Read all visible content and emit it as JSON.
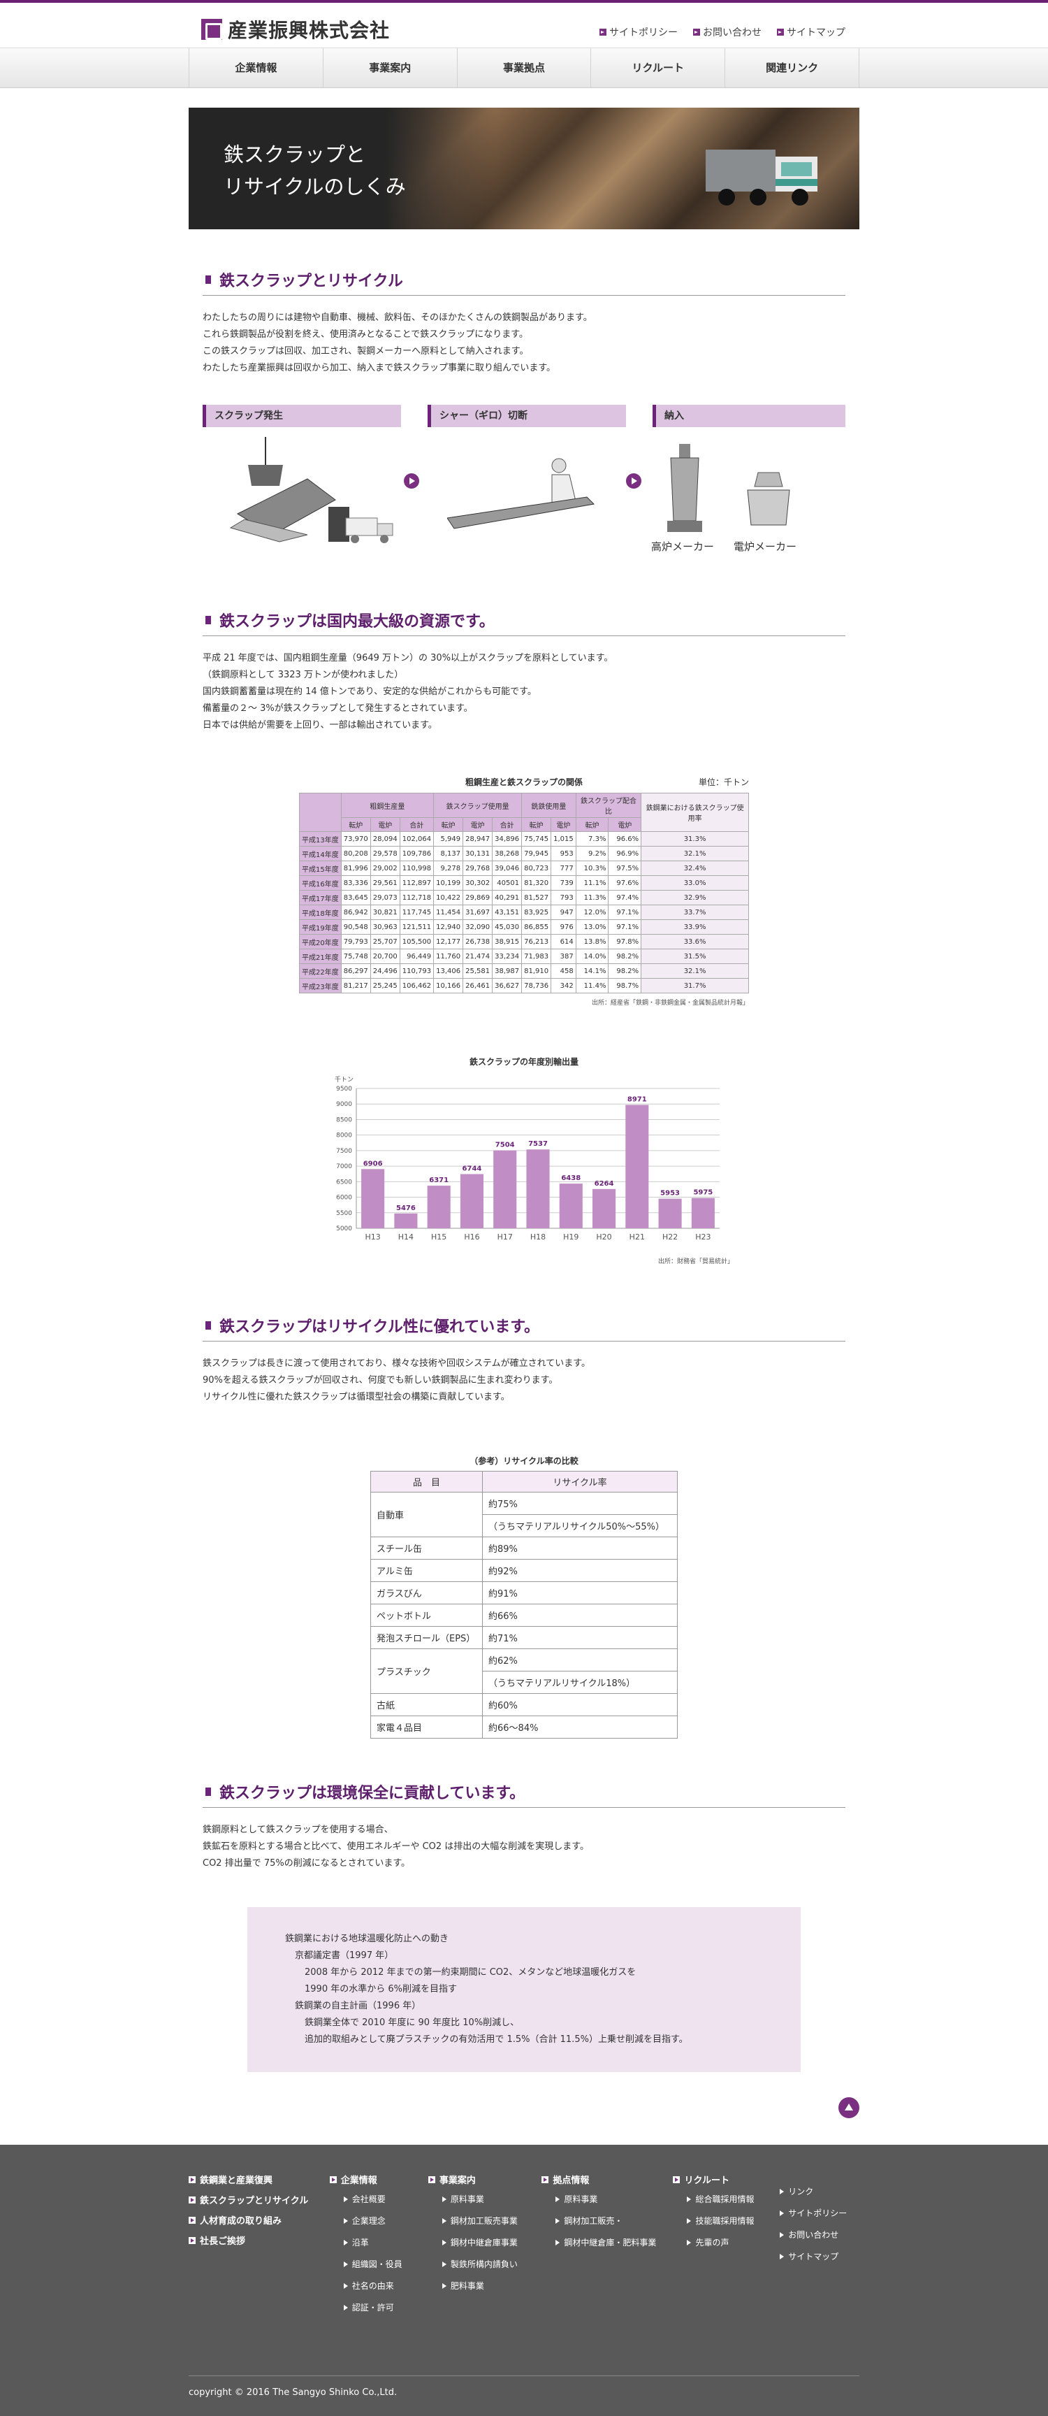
{
  "header": {
    "company": "産業振興株式会社",
    "util": [
      "サイトポリシー",
      "お問い合わせ",
      "サイトマップ"
    ]
  },
  "nav": [
    "企業情報",
    "事業案内",
    "事業拠点",
    "リクルート",
    "関連リンク"
  ],
  "hero": {
    "line1": "鉄スクラップと",
    "line2": "リサイクルのしくみ"
  },
  "s1": {
    "title": "鉄スクラップとリサイクル",
    "lines": [
      "わたしたちの周りには建物や自動車、機械、飲料缶、そのほかたくさんの鉄鋼製品があります。",
      "これら鉄鋼製品が役割を終え、使用済みとなることで鉄スクラップになります。",
      "この鉄スクラップは回収、加工され、製鋼メーカーへ原料として納入されます。",
      "わたしたち産業振興は回収から加工、納入まで鉄スクラップ事業に取り組んでいます。"
    ],
    "flow": [
      "スクラップ発生",
      "シャー（ギロ）切断",
      "納入"
    ],
    "captions": [
      "高炉メーカー",
      "電炉メーカー"
    ]
  },
  "s2": {
    "title": "鉄スクラップは国内最大級の資源です。",
    "lines": [
      "平成 21 年度では、国内粗鋼生産量（9649 万トン）の 30%以上がスクラップを原料としています。",
      "（鉄鋼原料として 3323 万トンが使われました）",
      "国内鉄鋼蓄蓄量は現在約 14 億トンであり、安定的な供給がこれからも可能です。",
      "備蓄量の２～ 3%が鉄スクラップとして発生するとされています。",
      "日本では供給が需要を上回り、一部は輸出されています。"
    ],
    "table": {
      "title": "粗鋼生産と鉄スクラップの関係",
      "unit": "単位：千トン",
      "groups": [
        "粗鋼生産量",
        "鉄スクラップ使用量",
        "銑鉄使用量",
        "鉄スクラップ配合比",
        "鉄鋼業における鉄スクラップ使用率"
      ],
      "sub": [
        "転炉",
        "電炉",
        "合計",
        "転炉",
        "電炉",
        "合計",
        "転炉",
        "電炉",
        "転炉",
        "電炉"
      ],
      "rows": [
        [
          "平成13年度",
          "73,970",
          "28,094",
          "102,064",
          "5,949",
          "28,947",
          "34,896",
          "75,745",
          "1,015",
          "7.3%",
          "96.6%",
          "31.3%"
        ],
        [
          "平成14年度",
          "80,208",
          "29,578",
          "109,786",
          "8,137",
          "30,131",
          "38,268",
          "79,945",
          "953",
          "9.2%",
          "96.9%",
          "32.1%"
        ],
        [
          "平成15年度",
          "81,996",
          "29,002",
          "110,998",
          "9,278",
          "29,768",
          "39,046",
          "80,723",
          "777",
          "10.3%",
          "97.5%",
          "32.4%"
        ],
        [
          "平成16年度",
          "83,336",
          "29,561",
          "112,897",
          "10,199",
          "30,302",
          "40501",
          "81,320",
          "739",
          "11.1%",
          "97.6%",
          "33.0%"
        ],
        [
          "平成17年度",
          "83,645",
          "29,073",
          "112,718",
          "10,422",
          "29,869",
          "40,291",
          "81,527",
          "793",
          "11.3%",
          "97.4%",
          "32.9%"
        ],
        [
          "平成18年度",
          "86,942",
          "30,821",
          "117,745",
          "11,454",
          "31,697",
          "43,151",
          "83,925",
          "947",
          "12.0%",
          "97.1%",
          "33.7%"
        ],
        [
          "平成19年度",
          "90,548",
          "30,963",
          "121,511",
          "12,940",
          "32,090",
          "45,030",
          "86,855",
          "976",
          "13.0%",
          "97.1%",
          "33.9%"
        ],
        [
          "平成20年度",
          "79,793",
          "25,707",
          "105,500",
          "12,177",
          "26,738",
          "38,915",
          "76,213",
          "614",
          "13.8%",
          "97.8%",
          "33.6%"
        ],
        [
          "平成21年度",
          "75,748",
          "20,700",
          "96,449",
          "11,760",
          "21,474",
          "33,234",
          "71,983",
          "387",
          "14.0%",
          "98.2%",
          "31.5%"
        ],
        [
          "平成22年度",
          "86,297",
          "24,496",
          "110,793",
          "13,406",
          "25,581",
          "38,987",
          "81,910",
          "458",
          "14.1%",
          "98.2%",
          "32.1%"
        ],
        [
          "平成23年度",
          "81,217",
          "25,245",
          "106,462",
          "10,166",
          "26,461",
          "36,627",
          "78,736",
          "342",
          "11.4%",
          "98.7%",
          "31.7%"
        ]
      ],
      "source": "出所：経産省「鉄鋼・非鉄鋼金属・金属製品統計月報」"
    }
  },
  "chart_data": {
    "type": "bar",
    "title": "鉄スクラップの年度別輸出量",
    "ylabel": "千トン",
    "categories": [
      "H13",
      "H14",
      "H15",
      "H16",
      "H17",
      "H18",
      "H19",
      "H20",
      "H21",
      "H22",
      "H23"
    ],
    "values": [
      6906,
      5476,
      6371,
      6744,
      7504,
      7537,
      6438,
      6264,
      8971,
      5953,
      5975
    ],
    "ylim": [
      5000,
      9500
    ],
    "yticks": [
      5000,
      5500,
      6000,
      6500,
      7000,
      7500,
      8000,
      8500,
      9000,
      9500
    ],
    "color": "#c08ec4",
    "grid": true,
    "source": "出所：財務省「貿易統計」"
  },
  "s3": {
    "title": "鉄スクラップはリサイクル性に優れています。",
    "lines": [
      "鉄スクラップは長きに渡って使用されており、様々な技術や回収システムが確立されています。",
      "90%を超える鉄スクラップが回収され、何度でも新しい鉄鋼製品に生まれ変わります。",
      "リサイクル性に優れた鉄スクラップは循環型社会の構築に貢献しています。"
    ],
    "table": {
      "title": "（参考）リサイクル率の比較",
      "h1": "品　目",
      "h2": "リサイクル率",
      "rows": [
        {
          "item": "自動車",
          "vals": [
            "約75%",
            "（うちマテリアルリサイクル50%～55%）"
          ]
        },
        {
          "item": "スチール缶",
          "vals": [
            "約89%"
          ]
        },
        {
          "item": "アルミ缶",
          "vals": [
            "約92%"
          ]
        },
        {
          "item": "ガラスびん",
          "vals": [
            "約91%"
          ]
        },
        {
          "item": "ペットボトル",
          "vals": [
            "約66%"
          ]
        },
        {
          "item": "発泡スチロール（EPS）",
          "vals": [
            "約71%"
          ]
        },
        {
          "item": "プラスチック",
          "vals": [
            "約62%",
            "（うちマテリアルリサイクル18%）"
          ]
        },
        {
          "item": "古紙",
          "vals": [
            "約60%"
          ]
        },
        {
          "item": "家電４品目",
          "vals": [
            "約66～84%"
          ]
        }
      ]
    }
  },
  "s4": {
    "title": "鉄スクラップは環境保全に貢献しています。",
    "lines": [
      "鉄鋼原料として鉄スクラップを使用する場合、",
      "鉄鉱石を原料とする場合と比べて、使用エネルギーや CO2 は排出の大幅な削減を実現します。",
      "CO2 排出量で 75%の削減になるとされています。"
    ],
    "box": [
      {
        "t": "鉄鋼業における地球温暖化防止への動き",
        "i": 0
      },
      {
        "t": "京都議定書（1997 年）",
        "i": 1
      },
      {
        "t": "2008 年から 2012 年までの第一約束期間に CO2、メタンなど地球温暖化ガスを",
        "i": 2
      },
      {
        "t": "1990 年の水準から 6%削減を目指す",
        "i": 2
      },
      {
        "t": "鉄鋼業の自主計画（1996 年）",
        "i": 1
      },
      {
        "t": "鉄鋼業全体で 2010 年度に 90 年度比 10%削減し、",
        "i": 2
      },
      {
        "t": "追加的取組みとして廃プラスチックの有効活用で 1.5%（合計 11.5%）上乗せ削減を目指す。",
        "i": 2
      }
    ]
  },
  "footer": {
    "col1": [
      "鉄鋼業と産業復興",
      "鉄スクラップとリサイクル",
      "人材育成の取り組み",
      "社長ご挨拶"
    ],
    "col2": {
      "h": "企業情報",
      "items": [
        "会社概要",
        "企業理念",
        "沿革",
        "組織図・役員",
        "社名の由来",
        "認証・許可"
      ]
    },
    "col3": {
      "h": "事業案内",
      "items": [
        "原料事業",
        "鋼材加工販売事業",
        "鋼材中継倉庫事業",
        "製鉄所構内請負い",
        "肥料事業"
      ]
    },
    "col4": {
      "h": "拠点情報",
      "items": [
        "原料事業",
        "鋼材加工販売・",
        "鋼材中継倉庫・肥料事業"
      ]
    },
    "col5": {
      "h": "リクルート",
      "items": [
        "総合職採用情報",
        "技能職採用情報",
        "先輩の声"
      ]
    },
    "col6": [
      "リンク",
      "サイトポリシー",
      "お問い合わせ",
      "サイトマップ"
    ],
    "copyright": "copyright © 2016 The Sangyo Shinko Co.,Ltd."
  }
}
